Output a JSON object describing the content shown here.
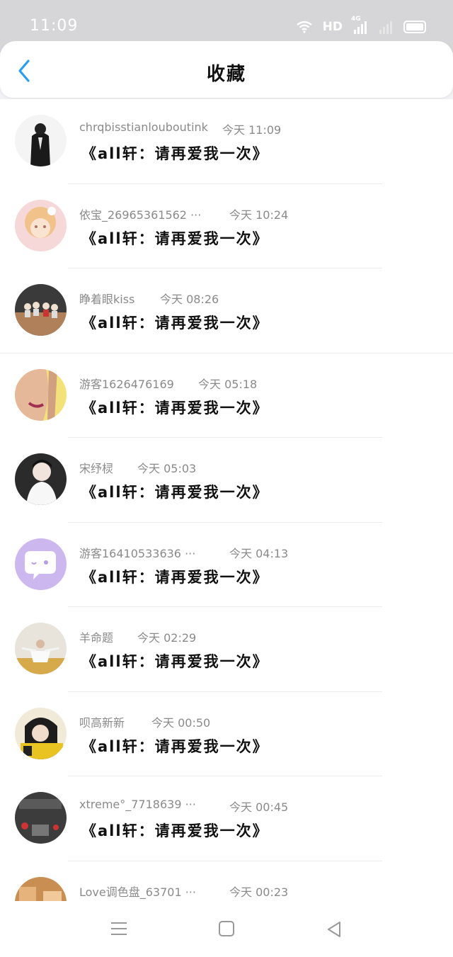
{
  "status_bar": {
    "time": "11:09",
    "network": "HD",
    "signal_label": "4G"
  },
  "header": {
    "title": "收藏"
  },
  "items": [
    {
      "name": "chrqbisstianlouboutink",
      "time": "今天 11:09",
      "content": "《all轩：请再爱我一次》"
    },
    {
      "name": "依宝_26965361562 ···",
      "time": "今天 10:24",
      "content": "《all轩：请再爱我一次》"
    },
    {
      "name": "睁着眼kiss",
      "time": "今天 08:26",
      "content": "《all轩：请再爱我一次》"
    },
    {
      "name": "游客1626476169",
      "time": "今天 05:18",
      "content": "《all轩：请再爱我一次》"
    },
    {
      "name": "宋纾棂",
      "time": "今天 05:03",
      "content": "《all轩：请再爱我一次》"
    },
    {
      "name": "游客16410533636 ···",
      "time": "今天 04:13",
      "content": "《all轩：请再爱我一次》"
    },
    {
      "name": "羊命题",
      "time": "今天 02:29",
      "content": "《all轩：请再爱我一次》"
    },
    {
      "name": "呗高新新",
      "time": "今天 00:50",
      "content": "《all轩：请再爱我一次》"
    },
    {
      "name": "xtreme°_7718639 ···",
      "time": "今天 00:45",
      "content": "《all轩：请再爱我一次》"
    },
    {
      "name": "Love调色盘_63701 ···",
      "time": "今天 00:23",
      "content": ""
    }
  ],
  "colors": {
    "accent": "#2a9df4",
    "name_text": "#8a8a8a",
    "content_text": "#111111"
  }
}
